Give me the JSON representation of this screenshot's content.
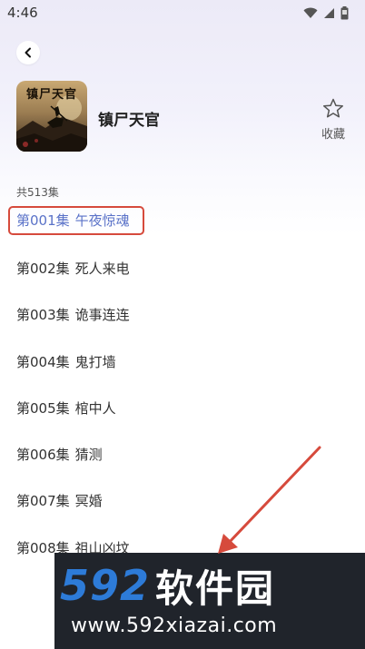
{
  "status_bar": {
    "time": "4:46",
    "icons": [
      "wifi-icon",
      "signal-icon",
      "battery-icon"
    ]
  },
  "header": {
    "back_icon": "chevron-left-icon",
    "cover_text": "镇尸天官",
    "title": "镇尸天官",
    "favorite_icon": "star-outline-icon",
    "favorite_label": "收藏"
  },
  "episodes_total": "共513集",
  "episodes": [
    {
      "number": "第001集",
      "title": "午夜惊魂",
      "active": true
    },
    {
      "number": "第002集",
      "title": "死人来电",
      "active": false
    },
    {
      "number": "第003集",
      "title": "诡事连连",
      "active": false
    },
    {
      "number": "第004集",
      "title": "鬼打墙",
      "active": false
    },
    {
      "number": "第005集",
      "title": "棺中人",
      "active": false
    },
    {
      "number": "第006集",
      "title": "猜测",
      "active": false
    },
    {
      "number": "第007集",
      "title": "冥婚",
      "active": false
    },
    {
      "number": "第008集",
      "title": "祖山凶坟",
      "active": false
    }
  ],
  "watermark": {
    "logo_number": "592",
    "logo_text": "软件园",
    "url": "www.592xiazai.com"
  },
  "colors": {
    "active_episode": "#5a72c8",
    "highlight_border": "#d64a3c",
    "annotation_arrow": "#d64a3c",
    "watermark_bg": "#20242b",
    "watermark_number": "#2d7bd8"
  }
}
